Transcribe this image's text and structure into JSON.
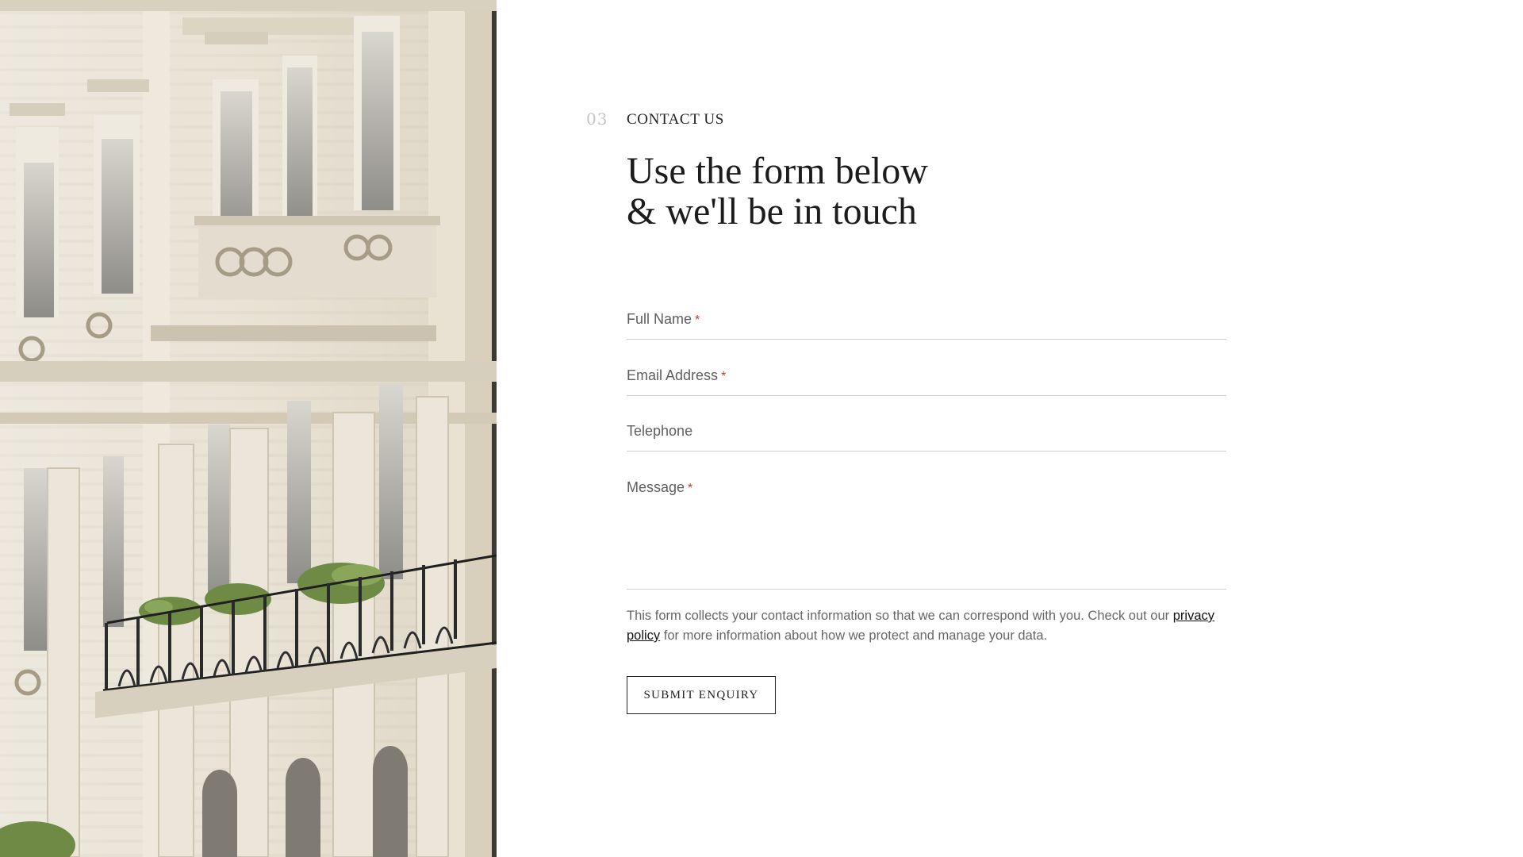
{
  "section": {
    "number": "03",
    "eyebrow": "CONTACT US",
    "heading_line1": "Use the form below",
    "heading_line2": "& we'll be in touch"
  },
  "form": {
    "fields": [
      {
        "label": "Full Name",
        "required": true
      },
      {
        "label": "Email Address",
        "required": true
      },
      {
        "label": "Telephone",
        "required": false
      },
      {
        "label": "Message",
        "required": true
      }
    ],
    "required_marker": "*",
    "notice_before": "This form collects your contact information so that we can correspond with you. Check out our ",
    "notice_link": "privacy policy",
    "notice_after": " for more information about how we protect and manage your data.",
    "submit_label": "SUBMIT ENQUIRY"
  },
  "colors": {
    "accent_required": "#c0392b",
    "text_dark": "#1c1c1c",
    "text_muted": "#666666",
    "section_number": "#c4c4c4",
    "rule": "#cfcfcf"
  }
}
